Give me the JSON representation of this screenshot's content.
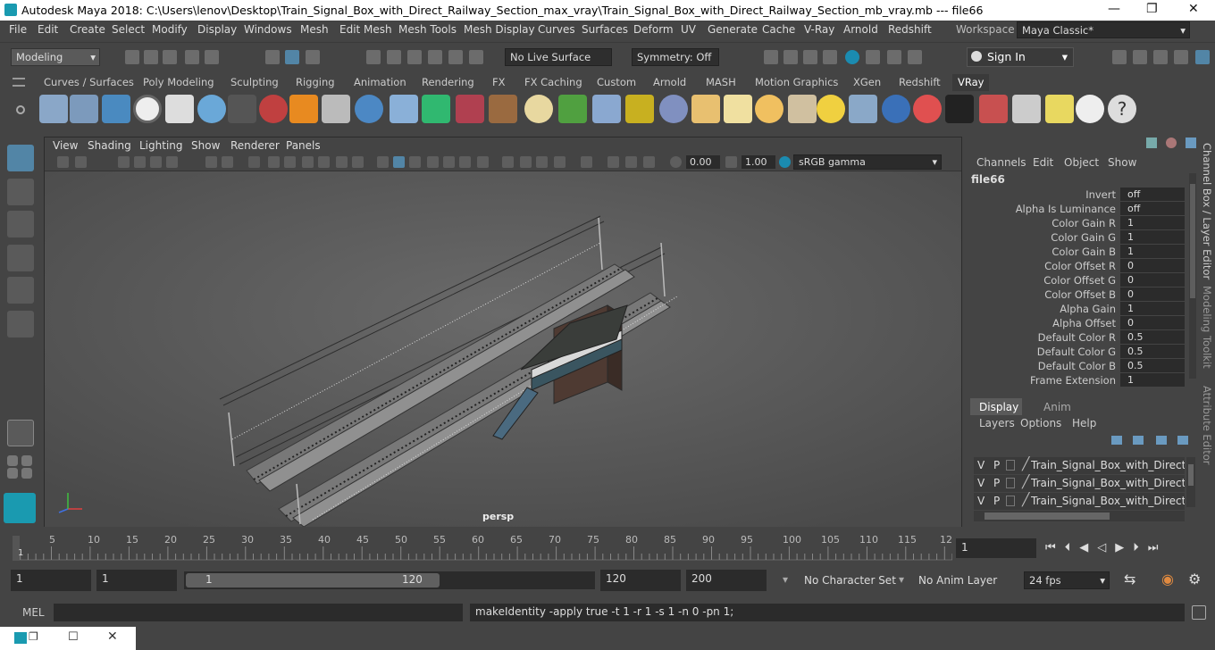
{
  "window": {
    "title": "Autodesk Maya 2018: C:\\Users\\lenov\\Desktop\\Train_Signal_Box_with_Direct_Railway_Section_max_vray\\Train_Signal_Box_with_Direct_Railway_Section_mb_vray.mb   ---   file66",
    "minimize": "—",
    "maximize": "❐",
    "close": "✕"
  },
  "menus": [
    "File",
    "Edit",
    "Create",
    "Select",
    "Modify",
    "Display",
    "Windows",
    "Mesh",
    "Edit Mesh",
    "Mesh Tools",
    "Mesh Display",
    "Curves",
    "Surfaces",
    "Deform",
    "UV",
    "Generate",
    "Cache",
    "V-Ray",
    "Arnold",
    "Redshift"
  ],
  "workspace": {
    "label": "Workspace :",
    "value": "Maya Classic*"
  },
  "status": {
    "mode": "Modeling",
    "live_surface": "No Live Surface",
    "symmetry": "Symmetry: Off",
    "sign_in": "Sign In"
  },
  "shelf_tabs": [
    "Curves / Surfaces",
    "Poly Modeling",
    "Sculpting",
    "Rigging",
    "Animation",
    "Rendering",
    "FX",
    "FX Caching",
    "Custom",
    "Arnold",
    "MASH",
    "Motion Graphics",
    "XGen",
    "Redshift",
    "VRay"
  ],
  "shelf_active": "VRay",
  "viewport": {
    "menus": [
      "View",
      "Shading",
      "Lighting",
      "Show",
      "Renderer",
      "Panels"
    ],
    "exposure": "0.00",
    "gamma": "1.00",
    "color_space": "sRGB gamma",
    "camera": "persp"
  },
  "channel_box": {
    "menus": [
      "Channels",
      "Edit",
      "Object",
      "Show"
    ],
    "node": "file66",
    "attributes": [
      {
        "label": "Invert",
        "value": "off"
      },
      {
        "label": "Alpha Is Luminance",
        "value": "off"
      },
      {
        "label": "Color Gain R",
        "value": "1"
      },
      {
        "label": "Color Gain G",
        "value": "1"
      },
      {
        "label": "Color Gain B",
        "value": "1"
      },
      {
        "label": "Color Offset R",
        "value": "0"
      },
      {
        "label": "Color Offset G",
        "value": "0"
      },
      {
        "label": "Color Offset B",
        "value": "0"
      },
      {
        "label": "Alpha Gain",
        "value": "1"
      },
      {
        "label": "Alpha Offset",
        "value": "0"
      },
      {
        "label": "Default Color R",
        "value": "0.5"
      },
      {
        "label": "Default Color G",
        "value": "0.5"
      },
      {
        "label": "Default Color B",
        "value": "0.5"
      },
      {
        "label": "Frame Extension",
        "value": "1"
      }
    ]
  },
  "side_tabs": [
    "Channel Box / Layer Editor",
    "Modeling Toolkit",
    "Attribute Editor"
  ],
  "layer_editor": {
    "tabs": [
      "Display",
      "Anim"
    ],
    "menus": [
      "Layers",
      "Options",
      "Help"
    ],
    "layers": [
      {
        "v": "V",
        "p": "P",
        "name": "Train_Signal_Box_with_Direct_Rai"
      },
      {
        "v": "V",
        "p": "P",
        "name": "Train_Signal_Box_with_Direct_Rai"
      },
      {
        "v": "V",
        "p": "P",
        "name": "Train_Signal_Box_with_Direct_Rai"
      }
    ]
  },
  "timeline": {
    "ticks": [
      "5",
      "10",
      "15",
      "20",
      "25",
      "30",
      "35",
      "40",
      "45",
      "50",
      "55",
      "60",
      "65",
      "70",
      "75",
      "80",
      "85",
      "90",
      "95",
      "100",
      "105",
      "110",
      "115",
      "12"
    ],
    "start_marker": "1",
    "current_frame": "1"
  },
  "range": {
    "start": "1",
    "playback_start": "1",
    "slider_start": "1",
    "slider_end": "120",
    "playback_end": "120",
    "end": "200",
    "character_set": "No Character Set",
    "anim_layer": "No Anim Layer",
    "fps": "24 fps"
  },
  "command": {
    "lang": "MEL",
    "result": "makeIdentity -apply true -t 1 -r 1 -s 1 -n 0 -pn 1;"
  }
}
